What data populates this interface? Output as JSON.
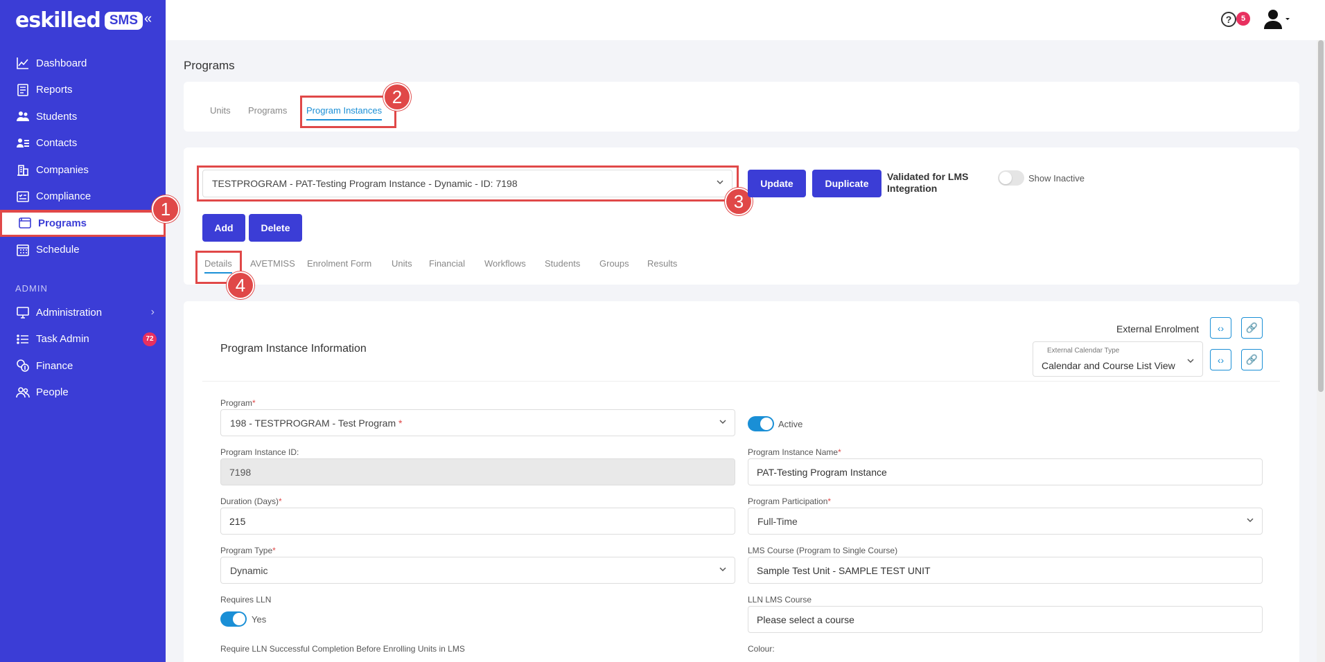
{
  "sidebar": {
    "logo_text": "eskilled",
    "logo_badge": "SMS",
    "items": [
      {
        "label": "Dashboard",
        "icon": "chart-line-icon"
      },
      {
        "label": "Reports",
        "icon": "report-icon"
      },
      {
        "label": "Students",
        "icon": "students-icon"
      },
      {
        "label": "Contacts",
        "icon": "contacts-icon"
      },
      {
        "label": "Companies",
        "icon": "building-icon"
      },
      {
        "label": "Compliance",
        "icon": "checklist-icon"
      },
      {
        "label": "Programs",
        "icon": "window-icon"
      },
      {
        "label": "Schedule",
        "icon": "calendar-icon"
      }
    ],
    "admin_label": "ADMIN",
    "admin_items": [
      {
        "label": "Administration",
        "icon": "monitor-icon"
      },
      {
        "label": "Task Admin",
        "icon": "list-icon",
        "badge": "72"
      },
      {
        "label": "Finance",
        "icon": "coins-icon"
      },
      {
        "label": "People",
        "icon": "people-icon"
      }
    ]
  },
  "topbar": {
    "help_symbol": "?",
    "help_badge": "5"
  },
  "page_title": "Programs",
  "top_tabs": [
    "Units",
    "Programs",
    "Program Instances"
  ],
  "instance_select": "TESTPROGRAM - PAT-Testing Program Instance - Dynamic - ID: 7198",
  "buttons": {
    "update": "Update",
    "duplicate": "Duplicate",
    "add": "Add",
    "delete": "Delete"
  },
  "lms_validated": "Validated for LMS Integration",
  "show_inactive": "Show Inactive",
  "detail_tabs": [
    "Details",
    "AVETMISS",
    "Enrolment Form",
    "Units",
    "Financial",
    "Workflows",
    "Students",
    "Groups",
    "Results"
  ],
  "annotations": [
    "1",
    "2",
    "3",
    "4"
  ],
  "info": {
    "title": "Program Instance Information",
    "external_enrolment": "External Enrolment",
    "calendar_type_label": "External Calendar Type",
    "calendar_type_value": "Calendar and Course List View",
    "program_label": "Program",
    "program_value": "198 - TESTPROGRAM - Test Program",
    "active_label": "Active",
    "instance_id_label": "Program Instance ID:",
    "instance_id_value": "7198",
    "instance_name_label": "Program Instance Name",
    "instance_name_value": "PAT-Testing Program Instance",
    "duration_label": "Duration (Days)",
    "duration_value": "215",
    "participation_label": "Program Participation",
    "participation_value": "Full-Time",
    "type_label": "Program Type",
    "type_value": "Dynamic",
    "lms_course_label": "LMS Course (Program to Single Course)",
    "lms_course_value": "Sample Test Unit - SAMPLE TEST UNIT",
    "requires_lln_label": "Requires LLN",
    "requires_lln_value": "Yes",
    "lln_lms_label": "LLN LMS Course",
    "lln_lms_value": "Please select a course",
    "require_lln_completion_label": "Require LLN Successful Completion Before Enrolling Units in LMS",
    "colour_label": "Colour:",
    "required_mark": "*"
  },
  "colors": {
    "sidebar": "#3b3dd6",
    "accent": "#1a8fd6",
    "highlight": "#e04848",
    "badge": "#e8305f"
  }
}
